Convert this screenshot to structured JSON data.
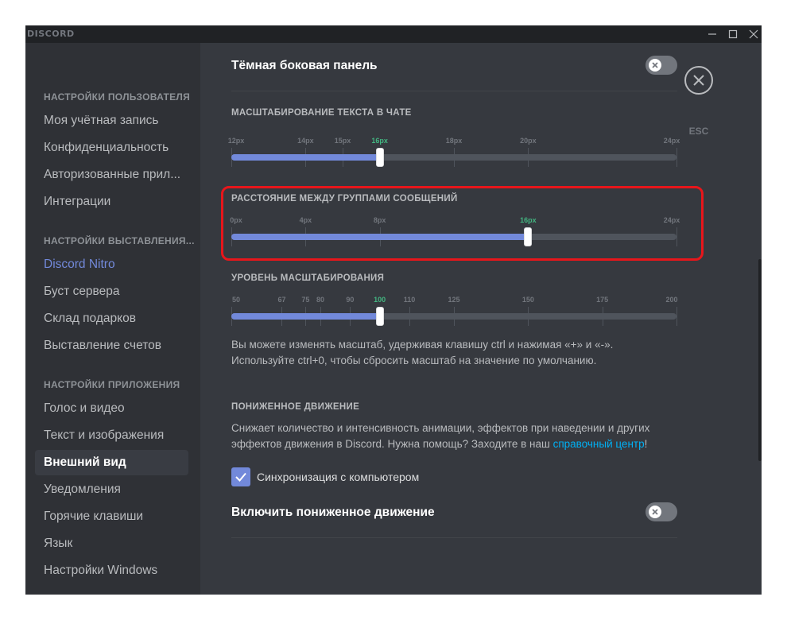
{
  "app": {
    "title": "DISCORD"
  },
  "sidebar": {
    "sections": [
      {
        "header": "НАСТРОЙКИ ПОЛЬЗОВАТЕЛЯ",
        "items": [
          "Моя учётная запись",
          "Конфиденциальность",
          "Авторизованные прил...",
          "Интеграции"
        ]
      },
      {
        "header": "НАСТРОЙКИ ВЫСТАВЛЕНИЯ...",
        "items": [
          "Discord Nitro",
          "Буст сервера",
          "Склад подарков",
          "Выставление счетов"
        ]
      },
      {
        "header": "НАСТРОЙКИ ПРИЛОЖЕНИЯ",
        "items": [
          "Голос и видео",
          "Текст и изображения",
          "Внешний вид",
          "Уведомления",
          "Горячие клавиши",
          "Язык",
          "Настройки Windows"
        ]
      }
    ],
    "active_item": "Внешний вид"
  },
  "content": {
    "dark_sidebar": {
      "label": "Тёмная боковая панель",
      "enabled": false
    },
    "text_scale": {
      "title": "МАСШТАБИРОВАНИЕ ТЕКСТА В ЧАТЕ",
      "markers": [
        "12px",
        "14px",
        "15px",
        "16px",
        "18px",
        "20px",
        "24px"
      ],
      "marker_values": [
        12,
        14,
        15,
        16,
        18,
        20,
        24
      ],
      "min": 12,
      "max": 24,
      "value": 16,
      "selected": "16px"
    },
    "message_spacing": {
      "title": "РАССТОЯНИЕ МЕЖДУ ГРУППАМИ СООБЩЕНИЙ",
      "markers": [
        "0px",
        "4px",
        "8px",
        "16px",
        "24px"
      ],
      "marker_values": [
        0,
        4,
        8,
        16,
        24
      ],
      "min": 0,
      "max": 24,
      "value": 16,
      "selected": "16px"
    },
    "zoom_level": {
      "title": "УРОВЕНЬ МАСШТАБИРОВАНИЯ",
      "markers": [
        "50",
        "67",
        "75",
        "80",
        "90",
        "100",
        "110",
        "125",
        "150",
        "175",
        "200"
      ],
      "marker_values": [
        50,
        67,
        75,
        80,
        90,
        100,
        110,
        125,
        150,
        175,
        200
      ],
      "min": 50,
      "max": 200,
      "value": 100,
      "selected": "100",
      "description": "Вы можете изменять масштаб, удерживая клавишу ctrl и нажимая «+» и «-». Используйте ctrl+0, чтобы сбросить масштаб на значение по умолчанию."
    },
    "reduced_motion": {
      "title": "ПОНИЖЕННОЕ ДВИЖЕНИЕ",
      "description": "Снижает количество и интенсивность анимации, эффектов при наведении и других эффектов движения в Discord. Нужна помощь? Заходите в наш ",
      "link_text": "справочный центр",
      "description_end": "!",
      "sync_label": "Синхронизация с компьютером",
      "sync_checked": true,
      "toggle_label": "Включить пониженное движение",
      "toggle_enabled": false
    }
  },
  "close": {
    "label": "ESC"
  },
  "colors": {
    "accent": "#7289da",
    "selected_marker": "#43b581",
    "link": "#00b0f4",
    "highlight": "#e8161b",
    "background": "#36393f",
    "sidebar": "#2f3136"
  }
}
